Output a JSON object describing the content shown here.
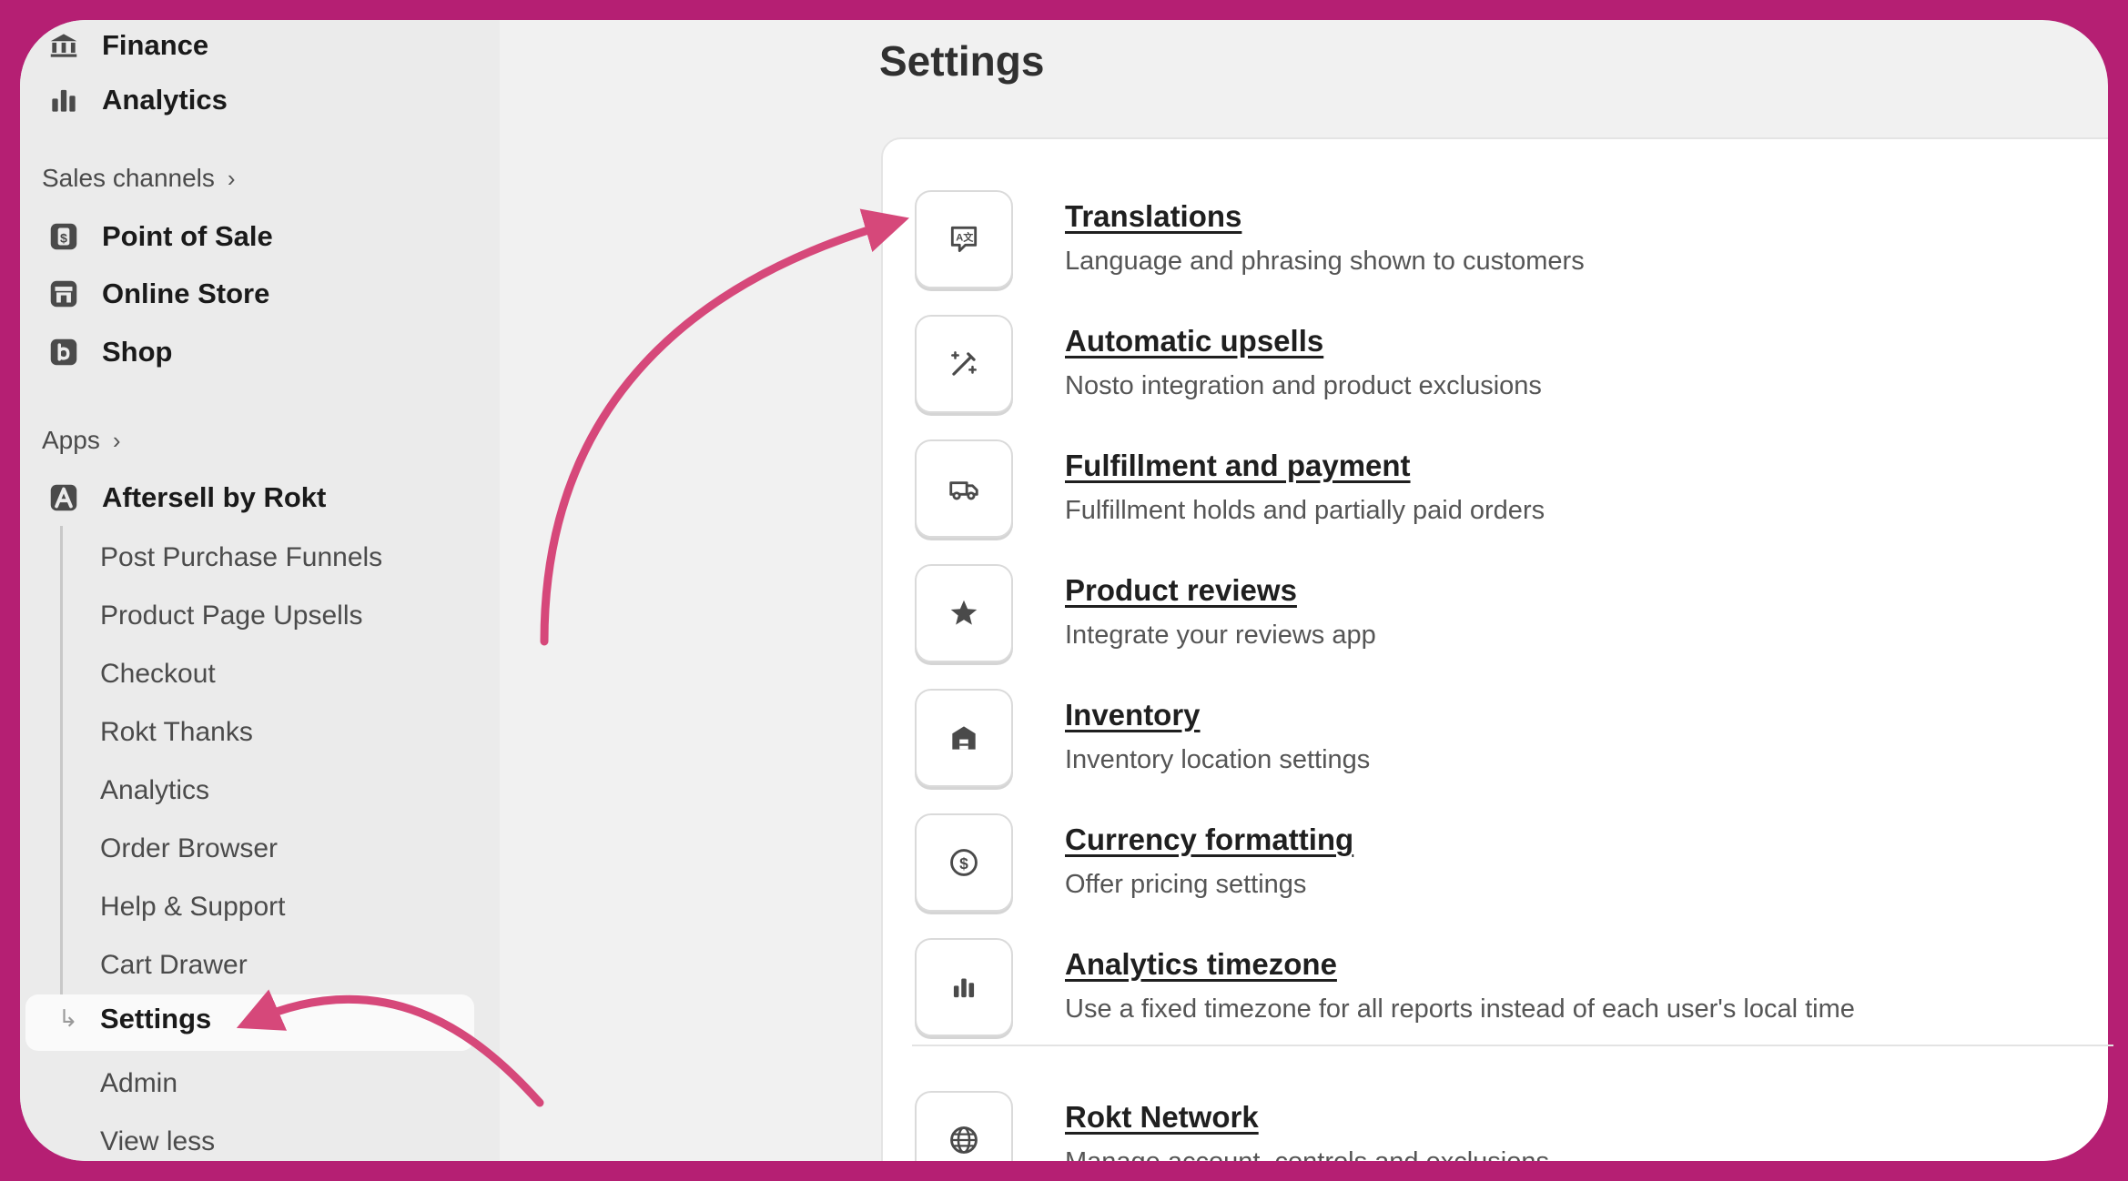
{
  "sidebar": {
    "top_items": [
      {
        "label": "Finance",
        "icon": "bank-icon"
      },
      {
        "label": "Analytics",
        "icon": "bar-chart-icon"
      }
    ],
    "sales_channels_heading": "Sales channels",
    "sales_channels": [
      {
        "label": "Point of Sale",
        "icon": "pos-icon"
      },
      {
        "label": "Online Store",
        "icon": "store-icon"
      },
      {
        "label": "Shop",
        "icon": "shop-icon"
      }
    ],
    "apps_heading": "Apps",
    "app": {
      "label": "Aftersell by Rokt",
      "icon": "aftersell-app-icon"
    },
    "app_subitems": [
      "Post Purchase Funnels",
      "Product Page Upsells",
      "Checkout",
      "Rokt Thanks",
      "Analytics",
      "Order Browser",
      "Help & Support",
      "Cart Drawer"
    ],
    "active_item": "Settings",
    "after_items": [
      "Admin",
      "View less"
    ]
  },
  "main": {
    "title": "Settings",
    "rows": [
      {
        "title": "Translations",
        "desc": "Language and phrasing shown to customers",
        "icon": "translate-icon"
      },
      {
        "title": "Automatic upsells",
        "desc": "Nosto integration and product exclusions",
        "icon": "magic-wand-icon"
      },
      {
        "title": "Fulfillment and payment",
        "desc": "Fulfillment holds and partially paid orders",
        "icon": "delivery-truck-icon"
      },
      {
        "title": "Product reviews",
        "desc": "Integrate your reviews app",
        "icon": "star-icon"
      },
      {
        "title": "Inventory",
        "desc": "Inventory location settings",
        "icon": "warehouse-icon"
      },
      {
        "title": "Currency formatting",
        "desc": "Offer pricing settings",
        "icon": "dollar-circle-icon"
      },
      {
        "title": "Analytics timezone",
        "desc": "Use a fixed timezone for all reports instead of each user's local time",
        "icon": "bar-chart-icon"
      },
      {
        "title": "Rokt Network",
        "desc": "Manage account, controls and exclusions",
        "icon": "globe-icon"
      }
    ]
  },
  "colors": {
    "frame_border": "#b51f73",
    "annotation_arrow": "#d6487a",
    "sidebar_bg": "#ebebeb",
    "main_bg": "#f1f1f1"
  }
}
